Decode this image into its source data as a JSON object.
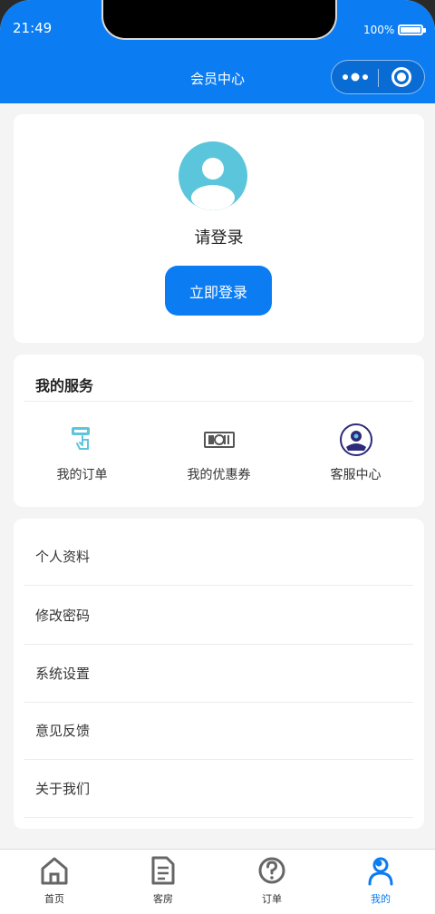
{
  "status_bar": {
    "time": "21:49",
    "battery": "100%"
  },
  "nav": {
    "title": "会员中心"
  },
  "login": {
    "prompt": "请登录",
    "button_label": "立即登录"
  },
  "services": {
    "title": "我的服务",
    "items": [
      {
        "label": "我的订单",
        "icon": "order-hand-icon"
      },
      {
        "label": "我的优惠券",
        "icon": "coupon-icon"
      },
      {
        "label": "客服中心",
        "icon": "customer-service-icon"
      }
    ]
  },
  "menu": {
    "items": [
      {
        "label": "个人资料"
      },
      {
        "label": "修改密码"
      },
      {
        "label": "系统设置"
      },
      {
        "label": "意见反馈"
      },
      {
        "label": "关于我们"
      }
    ]
  },
  "tabbar": {
    "items": [
      {
        "label": "首页",
        "icon": "home-icon"
      },
      {
        "label": "客房",
        "icon": "document-icon"
      },
      {
        "label": "订单",
        "icon": "question-icon"
      },
      {
        "label": "我的",
        "icon": "user-icon",
        "active": true
      }
    ]
  },
  "colors": {
    "brand": "#0b7cf2",
    "avatar": "#5bc5dc",
    "background": "#f4f4f4"
  }
}
